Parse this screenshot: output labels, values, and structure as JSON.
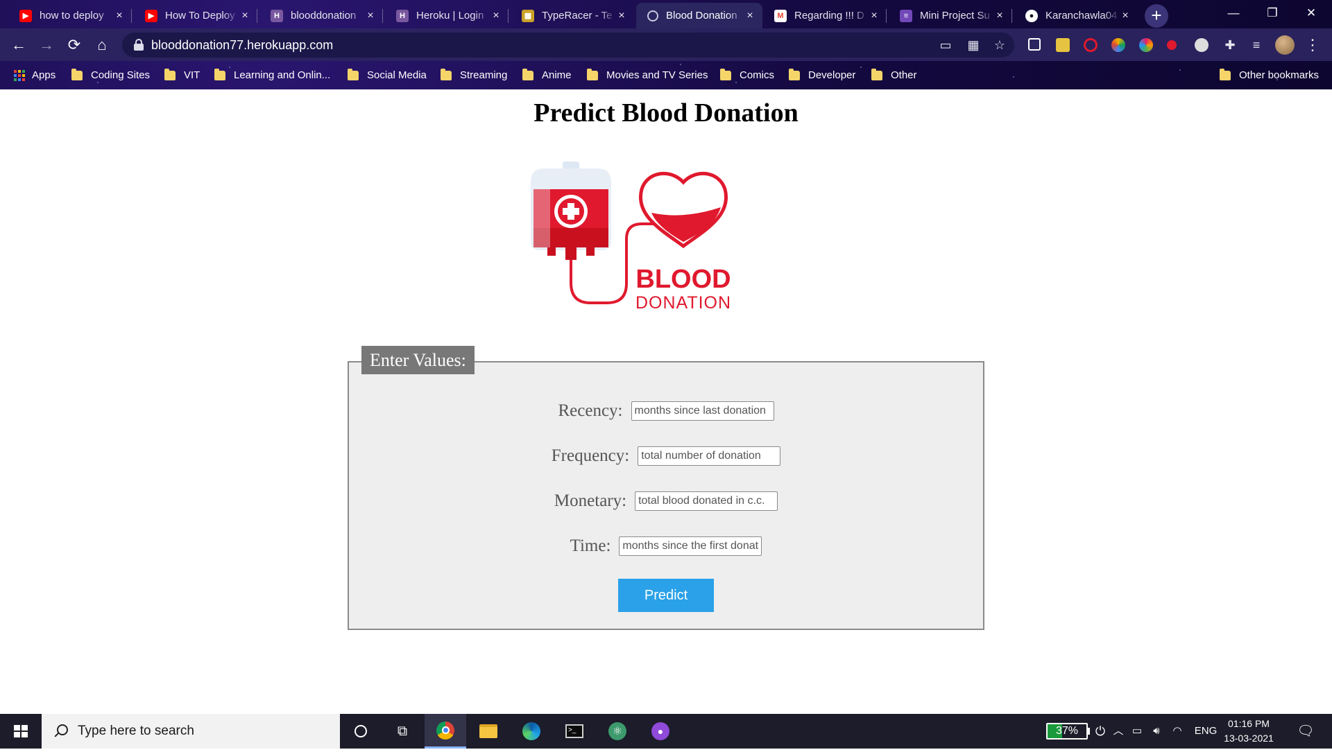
{
  "browser": {
    "tabs": [
      {
        "title": "how to deploy",
        "favicon": "youtube-icon",
        "color": "#ff0000",
        "active": false
      },
      {
        "title": "How To Deploy",
        "favicon": "youtube-icon",
        "color": "#ff0000",
        "active": false
      },
      {
        "title": "blooddonation",
        "favicon": "heroku-icon",
        "color": "#79589f",
        "active": false
      },
      {
        "title": "Heroku | Login",
        "favicon": "heroku-icon",
        "color": "#79589f",
        "active": false
      },
      {
        "title": "TypeRacer - Te",
        "favicon": "typeracer-icon",
        "color": "#c9a227",
        "active": false
      },
      {
        "title": "Blood Donation",
        "favicon": "globe-icon",
        "color": "#9aa0b5",
        "active": true
      },
      {
        "title": "Regarding !!! D",
        "favicon": "gmail-icon",
        "color": "#ea4335",
        "active": false
      },
      {
        "title": "Mini Project Su",
        "favicon": "forms-icon",
        "color": "#7248b9",
        "active": false
      },
      {
        "title": "Karanchawla04",
        "favicon": "github-icon",
        "color": "#ffffff",
        "active": false
      }
    ],
    "new_tab_label": "+",
    "url": "blooddonation77.herokuapp.com",
    "bookmarks": {
      "apps_label": "Apps",
      "folders": [
        "Coding Sites",
        "VIT",
        "Learning and Onlin...",
        "Social Media",
        "Streaming",
        "Anime",
        "Movies and TV Series",
        "Comics",
        "Developer",
        "Other"
      ],
      "other_bookmarks": "Other bookmarks"
    }
  },
  "page": {
    "title": "Predict Blood Donation",
    "logo_text_line1": "BLOOD",
    "logo_text_line2": "DONATION",
    "legend": "Enter Values:",
    "fields": [
      {
        "label": "Recency:",
        "placeholder": "months since last donation"
      },
      {
        "label": "Frequency:",
        "placeholder": "total number of donation"
      },
      {
        "label": "Monetary:",
        "placeholder": "total blood donated in c.c."
      },
      {
        "label": "Time:",
        "placeholder": "months since the first donation"
      }
    ],
    "predict_button": "Predict"
  },
  "taskbar": {
    "search_placeholder": "Type here to search",
    "battery_percent": "37%",
    "battery_level": 0.37,
    "language": "ENG",
    "time": "01:16 PM",
    "date": "13-03-2021"
  },
  "colors": {
    "accent_button": "#2aa1e8",
    "blood_red": "#e0192e",
    "form_background": "#eeeeee",
    "legend_background": "#787878"
  }
}
